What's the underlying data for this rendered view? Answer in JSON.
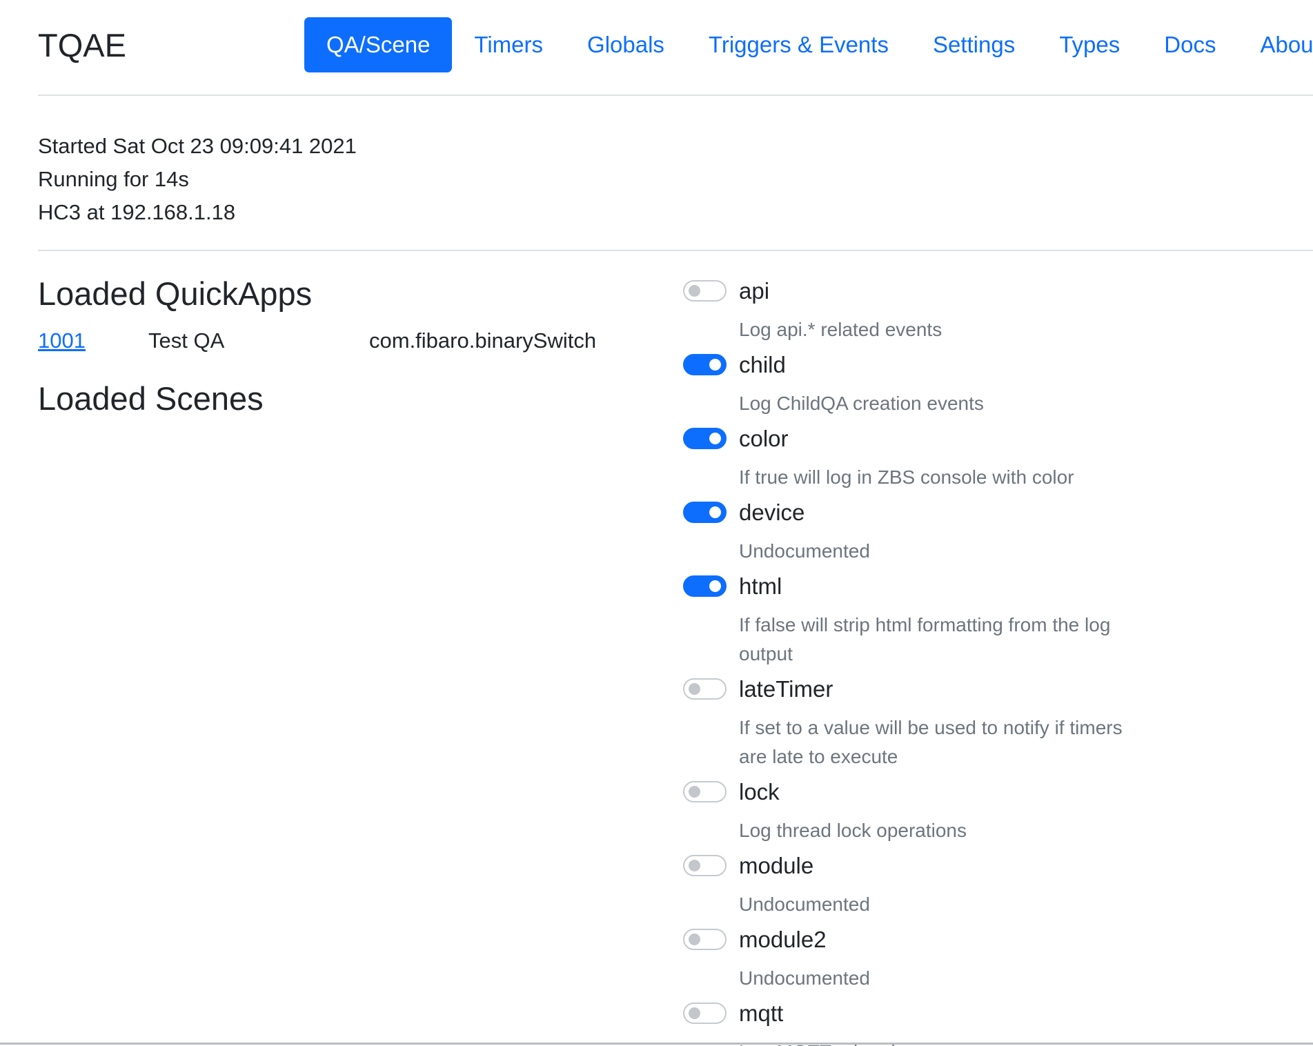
{
  "brand": "TQAE",
  "nav": [
    {
      "label": "QA/Scene",
      "active": true
    },
    {
      "label": "Timers",
      "active": false
    },
    {
      "label": "Globals",
      "active": false
    },
    {
      "label": "Triggers & Events",
      "active": false
    },
    {
      "label": "Settings",
      "active": false
    },
    {
      "label": "Types",
      "active": false
    },
    {
      "label": "Docs",
      "active": false
    },
    {
      "label": "About",
      "active": false
    }
  ],
  "status": {
    "started": "Started Sat Oct 23 09:09:41 2021",
    "running": "Running for 14s",
    "hc3": "HC3 at 192.168.1.18"
  },
  "quickapps": {
    "heading": "Loaded QuickApps",
    "items": [
      {
        "id": "1001",
        "name": "Test QA",
        "type": "com.fibaro.binarySwitch"
      }
    ]
  },
  "scenes": {
    "heading": "Loaded Scenes"
  },
  "settings": [
    {
      "name": "api",
      "on": false,
      "desc": "Log api.* related events"
    },
    {
      "name": "child",
      "on": true,
      "desc": "Log ChildQA creation events"
    },
    {
      "name": "color",
      "on": true,
      "desc": "If true will log in ZBS console with color"
    },
    {
      "name": "device",
      "on": true,
      "desc": "Undocumented"
    },
    {
      "name": "html",
      "on": true,
      "desc": "If false will strip html formatting from the log output"
    },
    {
      "name": "lateTimer",
      "on": false,
      "desc": "If set to a value will be used to notify if timers are late to execute"
    },
    {
      "name": "lock",
      "on": false,
      "desc": "Log thread lock operations"
    },
    {
      "name": "module",
      "on": false,
      "desc": "Undocumented"
    },
    {
      "name": "module2",
      "on": false,
      "desc": "Undocumented"
    },
    {
      "name": "mqtt",
      "on": false,
      "desc": "Log MQTT related events"
    }
  ]
}
